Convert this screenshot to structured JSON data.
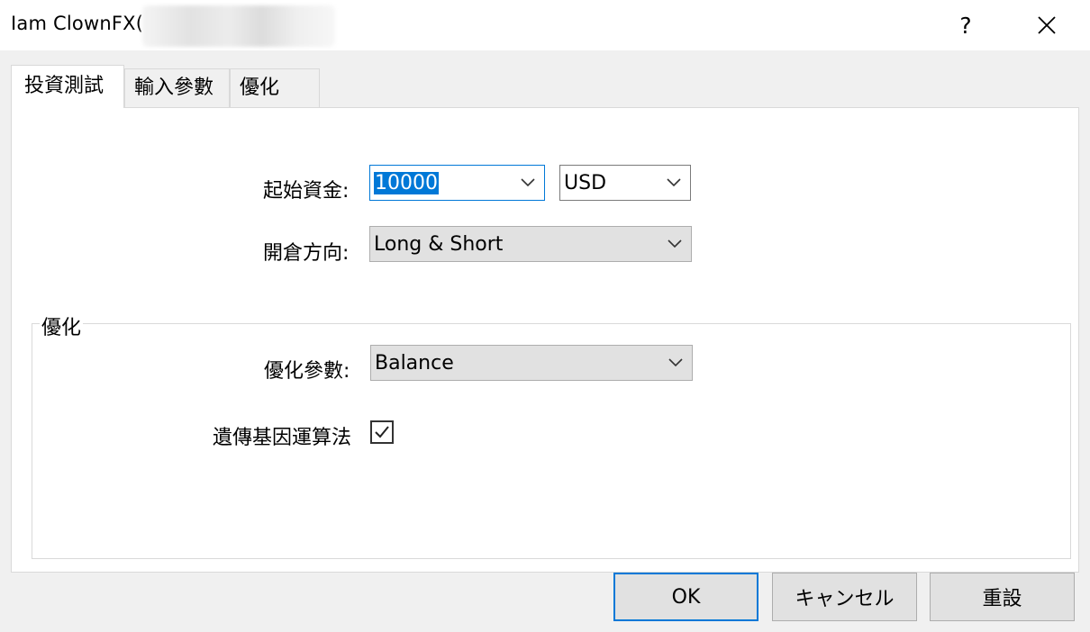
{
  "window": {
    "title": "Iam ClownFX(",
    "help_glyph": "?",
    "close_glyph": "✕"
  },
  "tabs": [
    {
      "label": "投資測試",
      "active": true
    },
    {
      "label": "輸入參數",
      "active": false
    },
    {
      "label": "優化",
      "active": false
    }
  ],
  "form": {
    "initial_deposit_label": "起始資金:",
    "initial_deposit_value": "10000",
    "currency_value": "USD",
    "position_label": "開倉方向:",
    "position_value": "Long & Short"
  },
  "optimization_group": {
    "legend": "優化",
    "param_label": "優化參數:",
    "param_value": "Balance",
    "genetic_label": "遺傳基因運算法",
    "genetic_checked": true
  },
  "buttons": {
    "ok": "OK",
    "cancel": "キャンセル",
    "reset": "重設"
  },
  "colors": {
    "accent": "#0078d7"
  }
}
